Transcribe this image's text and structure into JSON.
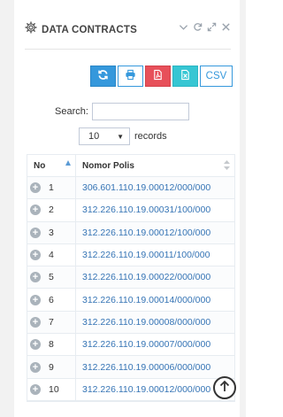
{
  "panel": {
    "title": "DATA CONTRACTS",
    "icons": [
      "gear-icon",
      "chevron-down-icon",
      "reload-icon",
      "expand-icon",
      "close-icon"
    ]
  },
  "toolbar": {
    "buttons": [
      "reload-icon",
      "print-icon",
      "pdf-icon",
      "excel-icon"
    ],
    "csv_label": "CSV",
    "colors": {
      "blue": "#3598dc",
      "red": "#e7505a",
      "teal": "#36c6d3"
    }
  },
  "search": {
    "label": "Search:",
    "value": "",
    "placeholder": ""
  },
  "length": {
    "selected": "10",
    "records_label": "records"
  },
  "table": {
    "headers": [
      "No",
      "Nomor Polis"
    ],
    "rows": [
      {
        "no": "1",
        "polis": "306.601.110.19.00012/000/000"
      },
      {
        "no": "2",
        "polis": "312.226.110.19.00031/100/000"
      },
      {
        "no": "3",
        "polis": "312.226.110.19.00012/100/000"
      },
      {
        "no": "4",
        "polis": "312.226.110.19.00011/100/000"
      },
      {
        "no": "5",
        "polis": "312.226.110.19.00022/000/000"
      },
      {
        "no": "6",
        "polis": "312.226.110.19.00014/000/000"
      },
      {
        "no": "7",
        "polis": "312.226.110.19.00008/000/000"
      },
      {
        "no": "8",
        "polis": "312.226.110.19.00007/000/000"
      },
      {
        "no": "9",
        "polis": "312.226.110.19.00006/000/000"
      },
      {
        "no": "10",
        "polis": "312.226.110.19.00012/000/000"
      }
    ]
  }
}
